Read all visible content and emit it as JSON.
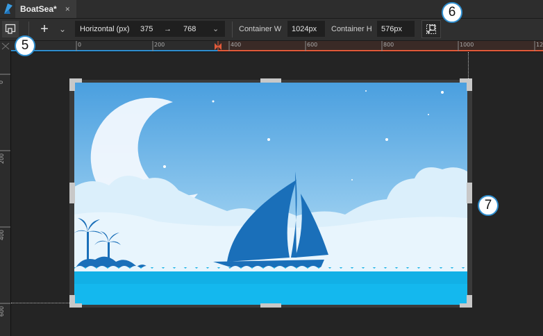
{
  "window": {
    "tab_title": "BoatSea*",
    "tab_close": "×"
  },
  "toolbar": {
    "add_glyph": "+",
    "dropdown_glyph": "⌄",
    "orientation_value": "Horizontal (px)",
    "range_start": "375",
    "range_arrow": "→",
    "range_end": "768",
    "container_w_label": "Container W",
    "container_w_value": "1024px",
    "container_h_label": "Container H",
    "container_h_value": "576px"
  },
  "ruler": {
    "h_labels": [
      "0",
      "200",
      "400",
      "600",
      "800",
      "1000",
      "12"
    ],
    "v_labels": [
      "0",
      "200",
      "400",
      "600"
    ]
  },
  "callouts": [
    "5",
    "6",
    "7"
  ],
  "colors": {
    "accent_blue": "#2f8fd0",
    "range_orange": "#e25a3a",
    "sky_top": "#4a9fdf",
    "sea": "#12b0e6",
    "boat": "#1a6fb9"
  },
  "icons": {
    "app_logo": "app-logo-icon",
    "preview": "device-preview-icon",
    "fit": "fit-to-screen-icon"
  }
}
